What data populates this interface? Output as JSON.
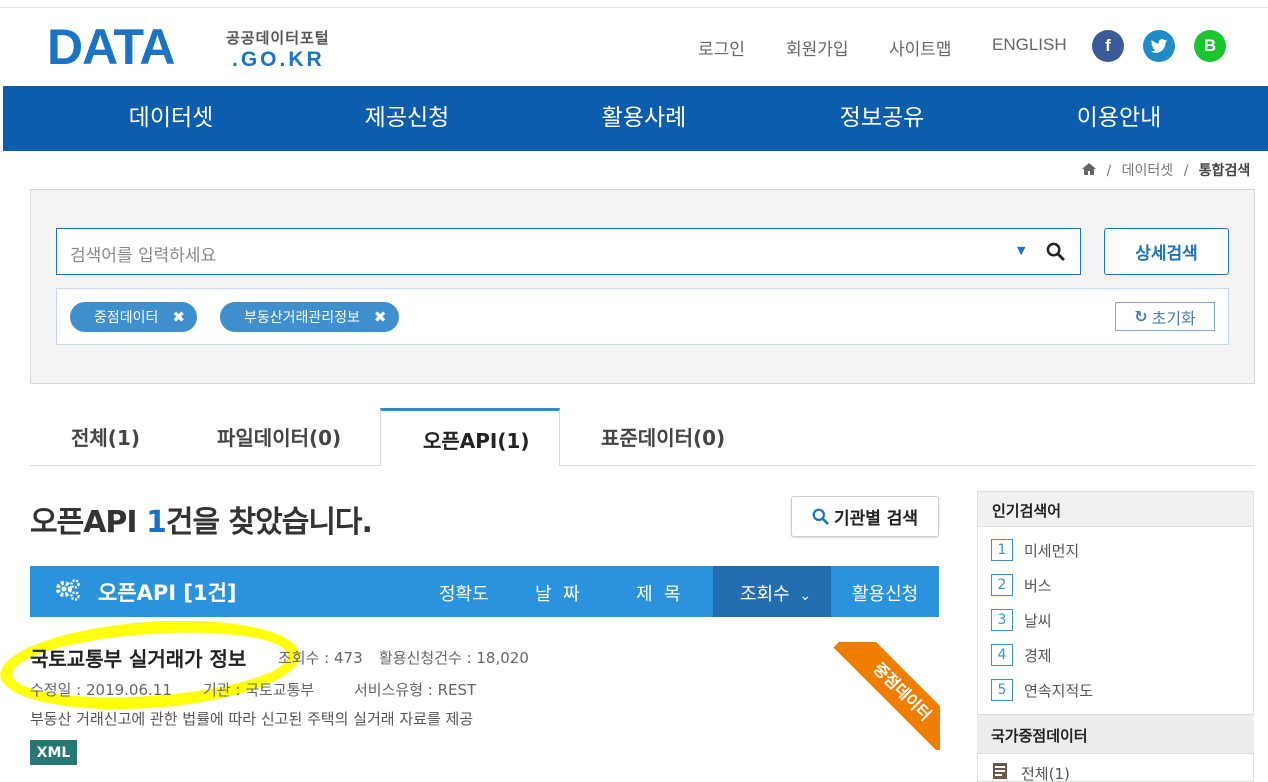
{
  "header": {
    "logo_main": "DATA",
    "logo_title": "공공데이터포털",
    "logo_sub": ".GO.KR",
    "util_links": [
      "로그인",
      "회원가입",
      "사이트맵",
      "ENGLISH"
    ],
    "sns": [
      "f",
      "t",
      "B"
    ]
  },
  "gnb": [
    "데이터셋",
    "제공신청",
    "활용사례",
    "정보공유",
    "이용안내"
  ],
  "breadcrumb": {
    "home_icon": "home-icon",
    "items": [
      "데이터셋",
      "통합검색"
    ]
  },
  "search": {
    "placeholder": "검색어를 입력하세요",
    "advanced_label": "상세검색",
    "chips": [
      "중점데이터",
      "부동산거래관리정보"
    ],
    "reset_label": "초기화"
  },
  "tabs": [
    "전체(1)",
    "파일데이터(0)",
    "오픈API(1)",
    "표준데이터(0)"
  ],
  "results": {
    "title_prefix": "오픈API ",
    "count": "1",
    "title_suffix": "건을 찾았습니다.",
    "agency_search_label": "기관별 검색"
  },
  "listbar": {
    "title": "오픈API [1건]",
    "sort_options": [
      "정확도",
      "날  짜",
      "제  목",
      "조회수"
    ],
    "apply_label": "활용신청"
  },
  "item": {
    "title": "국토교통부 실거래가 정보",
    "views": "조회수 : 473",
    "applications": "활용신청건수 : 18,020",
    "modified": "수정일 : 2019.06.11",
    "agency": "기관 : 국토교통부",
    "service_type": "서비스유형 : REST",
    "description": "부동산 거래신고에 관한 법률에 따라 신고된 주택의 실거래 자료를 제공",
    "badge": "XML",
    "ribbon": "중점데이터"
  },
  "sidebar": {
    "popular_title": "인기검색어",
    "popular": [
      {
        "rank": "1",
        "term": "미세먼지"
      },
      {
        "rank": "2",
        "term": "버스"
      },
      {
        "rank": "3",
        "term": "날씨"
      },
      {
        "rank": "4",
        "term": "경제"
      },
      {
        "rank": "5",
        "term": "연속지적도"
      }
    ],
    "national_title": "국가중점데이터",
    "national_all": "전체(1)"
  },
  "colors": {
    "brand_blue": "#1a73c5",
    "gnb_blue": "#0d5dae",
    "listbar_blue": "#2b92dd",
    "ribbon_orange": "#ef7d00",
    "badge_teal": "#277873",
    "highlight_yellow": "#ffff00"
  }
}
